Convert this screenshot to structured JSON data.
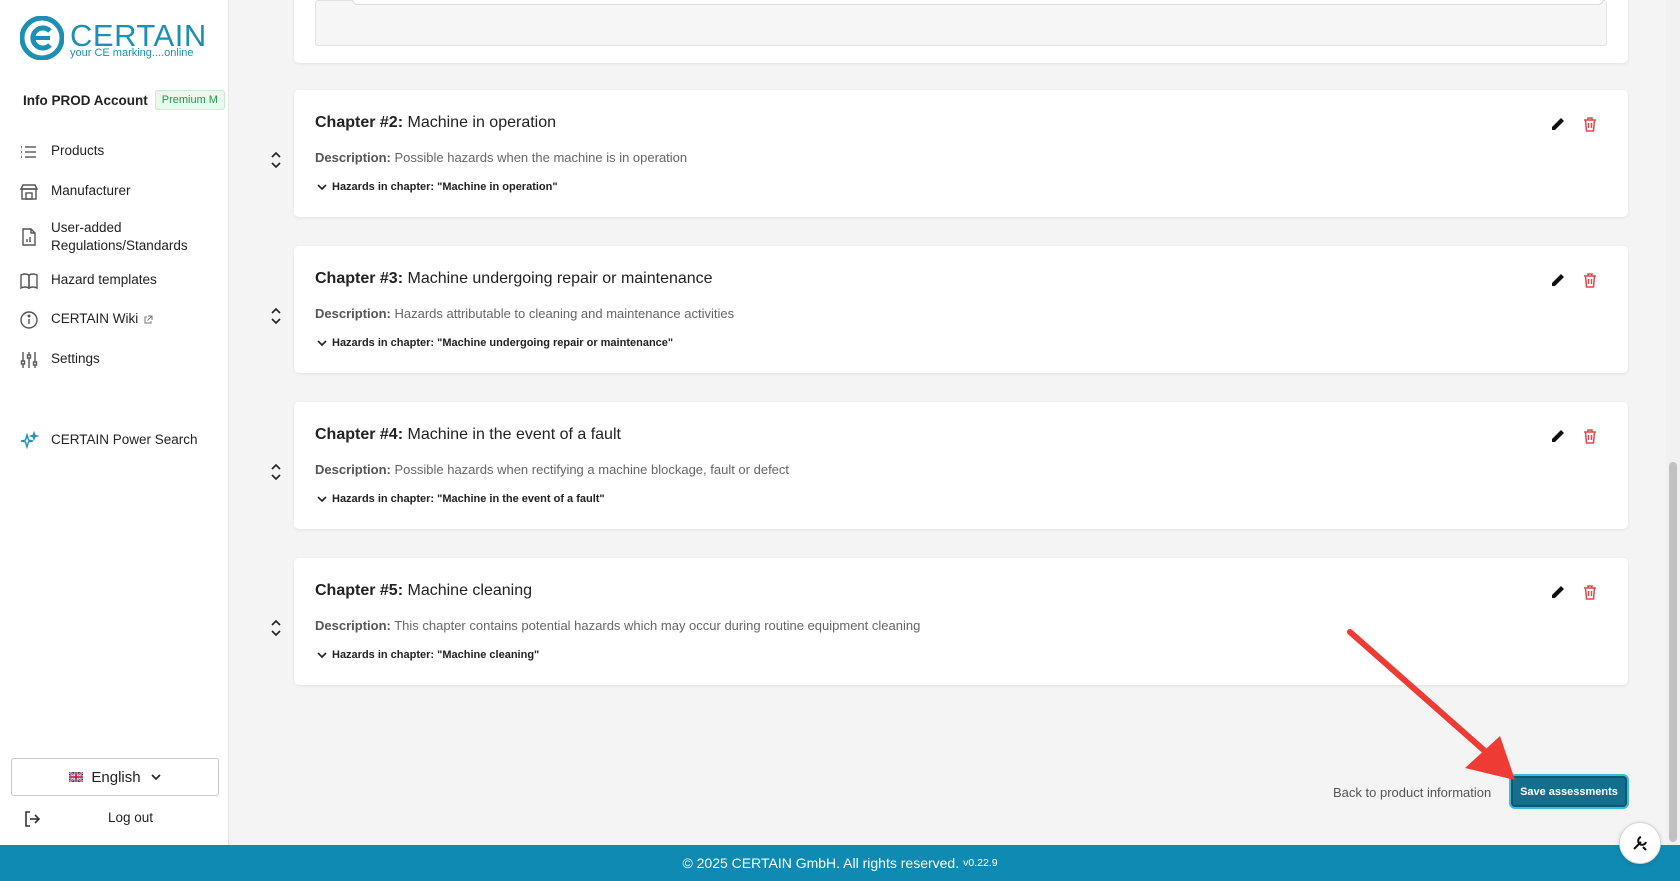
{
  "brand": {
    "name": "CERTAIN",
    "tagline": "your CE marking....online",
    "color": "#1d8fb5"
  },
  "account": {
    "name": "Info PROD Account",
    "plan": "Premium M"
  },
  "nav": [
    {
      "label": "Products",
      "icon": "list-icon"
    },
    {
      "label": "Manufacturer",
      "icon": "store-icon"
    },
    {
      "label": "User-added Regulations/Standards",
      "icon": "document-chart-icon"
    },
    {
      "label": "Hazard templates",
      "icon": "book-icon"
    },
    {
      "label": "CERTAIN Wiki",
      "icon": "info-icon"
    },
    {
      "label": "Settings",
      "icon": "sliders-icon"
    },
    {
      "label": "CERTAIN Power Search",
      "icon": "sparkles-icon"
    }
  ],
  "language": {
    "selected": "English"
  },
  "logout_label": "Log out",
  "chapters": [
    {
      "prefix": "Chapter #2:",
      "name": "Machine in operation",
      "desc_label": "Description:",
      "desc": "Possible hazards when the machine is in operation",
      "hazards": "Hazards in chapter: \"Machine in operation\""
    },
    {
      "prefix": "Chapter #3:",
      "name": "Machine undergoing repair or maintenance",
      "desc_label": "Description:",
      "desc": "Hazards attributable to cleaning and maintenance activities",
      "hazards": "Hazards in chapter: \"Machine undergoing repair or maintenance\""
    },
    {
      "prefix": "Chapter #4:",
      "name": "Machine in the event of a fault",
      "desc_label": "Description:",
      "desc": "Possible hazards when rectifying a machine blockage, fault or defect",
      "hazards": "Hazards in chapter: \"Machine in the event of a fault\""
    },
    {
      "prefix": "Chapter #5:",
      "name": "Machine cleaning",
      "desc_label": "Description:",
      "desc": "This chapter contains potential hazards which may occur during routine equipment cleaning",
      "hazards": "Hazards in chapter: \"Machine cleaning\""
    }
  ],
  "actions": {
    "back": "Back to product information",
    "save": "Save assessments"
  },
  "footer": {
    "copyright": "© 2025 CERTAIN GmbH. All rights reserved.",
    "version": "v0.22.9"
  },
  "colors": {
    "accent": "#136f8c",
    "footer": "#0f8bb3",
    "delete": "#e04848",
    "annotation": "#ee3b34"
  }
}
